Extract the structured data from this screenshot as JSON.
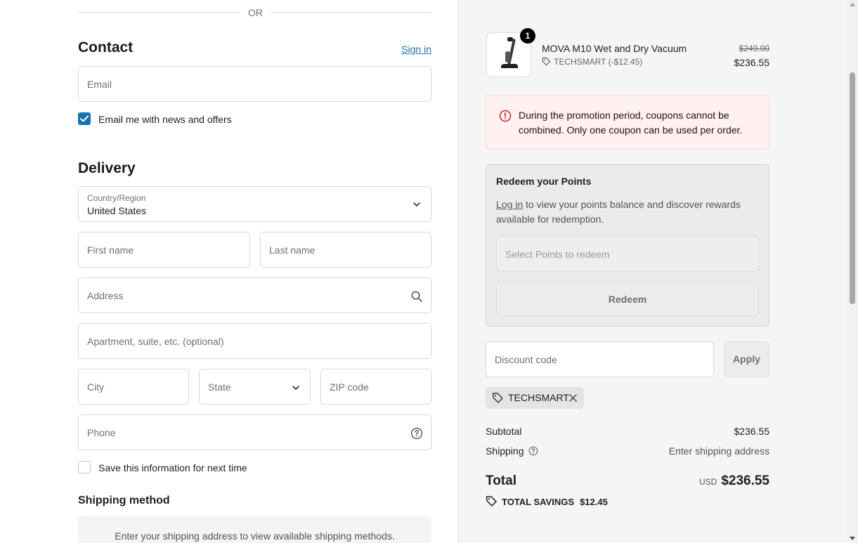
{
  "divider": {
    "text": "OR"
  },
  "contact": {
    "title": "Contact",
    "sign_in": "Sign in",
    "email_placeholder": "Email",
    "news_label": "Email me with news and offers",
    "news_checked": true
  },
  "delivery": {
    "title": "Delivery",
    "country_label": "Country/Region",
    "country_value": "United States",
    "first_name": "First name",
    "last_name": "Last name",
    "address": "Address",
    "apartment": "Apartment, suite, etc. (optional)",
    "city": "City",
    "state": "State",
    "zip": "ZIP code",
    "phone": "Phone",
    "save_label": "Save this information for next time",
    "save_checked": false
  },
  "shipping_method": {
    "title": "Shipping method",
    "message": "Enter your shipping address to view available shipping methods."
  },
  "order": {
    "quantity": "1",
    "product_name": "MOVA M10 Wet and Dry Vacuum",
    "discount_line": "TECHSMART (-$12.45)",
    "original_price": "$249.00",
    "price": "$236.55"
  },
  "alert": {
    "message": "During the promotion period, coupons cannot be combined. Only one coupon can be used per order."
  },
  "points": {
    "title": "Redeem your Points",
    "login_link": "Log in",
    "description": " to view your points balance and discover rewards available for redemption.",
    "select_placeholder": "Select Points to redeem",
    "redeem_label": "Redeem"
  },
  "discount": {
    "placeholder": "Discount code",
    "apply_label": "Apply",
    "applied_code": "TECHSMART"
  },
  "summary": {
    "subtotal_label": "Subtotal",
    "subtotal_value": "$236.55",
    "shipping_label": "Shipping",
    "shipping_value": "Enter shipping address",
    "total_label": "Total",
    "currency": "USD",
    "total_value": "$236.55",
    "savings_label": "TOTAL SAVINGS",
    "savings_value": "$12.45"
  },
  "colors": {
    "accent": "#1773b0",
    "alert_bg": "#fff1f1",
    "alert_icon": "#c72c2c"
  }
}
